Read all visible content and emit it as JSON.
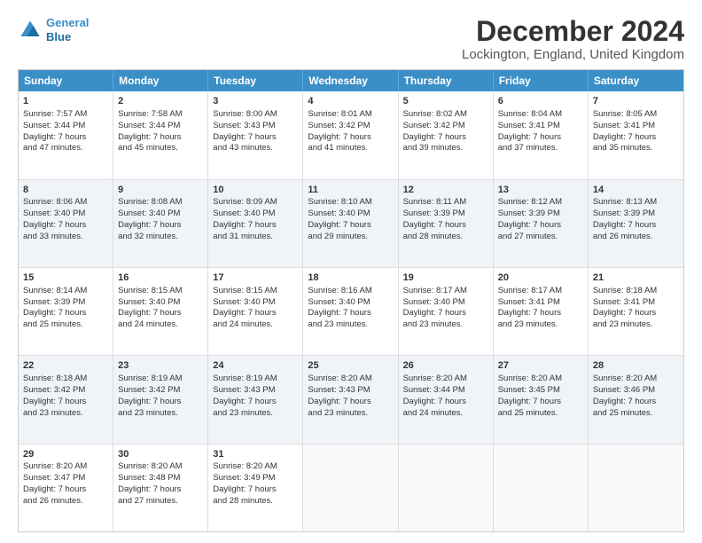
{
  "header": {
    "logo_line1": "General",
    "logo_line2": "Blue",
    "title": "December 2024",
    "subtitle": "Lockington, England, United Kingdom"
  },
  "days": [
    "Sunday",
    "Monday",
    "Tuesday",
    "Wednesday",
    "Thursday",
    "Friday",
    "Saturday"
  ],
  "rows": [
    [
      {
        "day": 1,
        "rise": "7:57 AM",
        "set": "3:44 PM",
        "daylight": "7 hours and 47 minutes."
      },
      {
        "day": 2,
        "rise": "7:58 AM",
        "set": "3:44 PM",
        "daylight": "7 hours and 45 minutes."
      },
      {
        "day": 3,
        "rise": "8:00 AM",
        "set": "3:43 PM",
        "daylight": "7 hours and 43 minutes."
      },
      {
        "day": 4,
        "rise": "8:01 AM",
        "set": "3:42 PM",
        "daylight": "7 hours and 41 minutes."
      },
      {
        "day": 5,
        "rise": "8:02 AM",
        "set": "3:42 PM",
        "daylight": "7 hours and 39 minutes."
      },
      {
        "day": 6,
        "rise": "8:04 AM",
        "set": "3:41 PM",
        "daylight": "7 hours and 37 minutes."
      },
      {
        "day": 7,
        "rise": "8:05 AM",
        "set": "3:41 PM",
        "daylight": "7 hours and 35 minutes."
      }
    ],
    [
      {
        "day": 8,
        "rise": "8:06 AM",
        "set": "3:40 PM",
        "daylight": "7 hours and 33 minutes."
      },
      {
        "day": 9,
        "rise": "8:08 AM",
        "set": "3:40 PM",
        "daylight": "7 hours and 32 minutes."
      },
      {
        "day": 10,
        "rise": "8:09 AM",
        "set": "3:40 PM",
        "daylight": "7 hours and 31 minutes."
      },
      {
        "day": 11,
        "rise": "8:10 AM",
        "set": "3:40 PM",
        "daylight": "7 hours and 29 minutes."
      },
      {
        "day": 12,
        "rise": "8:11 AM",
        "set": "3:39 PM",
        "daylight": "7 hours and 28 minutes."
      },
      {
        "day": 13,
        "rise": "8:12 AM",
        "set": "3:39 PM",
        "daylight": "7 hours and 27 minutes."
      },
      {
        "day": 14,
        "rise": "8:13 AM",
        "set": "3:39 PM",
        "daylight": "7 hours and 26 minutes."
      }
    ],
    [
      {
        "day": 15,
        "rise": "8:14 AM",
        "set": "3:39 PM",
        "daylight": "7 hours and 25 minutes."
      },
      {
        "day": 16,
        "rise": "8:15 AM",
        "set": "3:40 PM",
        "daylight": "7 hours and 24 minutes."
      },
      {
        "day": 17,
        "rise": "8:15 AM",
        "set": "3:40 PM",
        "daylight": "7 hours and 24 minutes."
      },
      {
        "day": 18,
        "rise": "8:16 AM",
        "set": "3:40 PM",
        "daylight": "7 hours and 23 minutes."
      },
      {
        "day": 19,
        "rise": "8:17 AM",
        "set": "3:40 PM",
        "daylight": "7 hours and 23 minutes."
      },
      {
        "day": 20,
        "rise": "8:17 AM",
        "set": "3:41 PM",
        "daylight": "7 hours and 23 minutes."
      },
      {
        "day": 21,
        "rise": "8:18 AM",
        "set": "3:41 PM",
        "daylight": "7 hours and 23 minutes."
      }
    ],
    [
      {
        "day": 22,
        "rise": "8:18 AM",
        "set": "3:42 PM",
        "daylight": "7 hours and 23 minutes."
      },
      {
        "day": 23,
        "rise": "8:19 AM",
        "set": "3:42 PM",
        "daylight": "7 hours and 23 minutes."
      },
      {
        "day": 24,
        "rise": "8:19 AM",
        "set": "3:43 PM",
        "daylight": "7 hours and 23 minutes."
      },
      {
        "day": 25,
        "rise": "8:20 AM",
        "set": "3:43 PM",
        "daylight": "7 hours and 23 minutes."
      },
      {
        "day": 26,
        "rise": "8:20 AM",
        "set": "3:44 PM",
        "daylight": "7 hours and 24 minutes."
      },
      {
        "day": 27,
        "rise": "8:20 AM",
        "set": "3:45 PM",
        "daylight": "7 hours and 25 minutes."
      },
      {
        "day": 28,
        "rise": "8:20 AM",
        "set": "3:46 PM",
        "daylight": "7 hours and 25 minutes."
      }
    ],
    [
      {
        "day": 29,
        "rise": "8:20 AM",
        "set": "3:47 PM",
        "daylight": "7 hours and 26 minutes."
      },
      {
        "day": 30,
        "rise": "8:20 AM",
        "set": "3:48 PM",
        "daylight": "7 hours and 27 minutes."
      },
      {
        "day": 31,
        "rise": "8:20 AM",
        "set": "3:49 PM",
        "daylight": "7 hours and 28 minutes."
      },
      null,
      null,
      null,
      null
    ]
  ],
  "alt_rows": [
    1,
    3
  ],
  "labels": {
    "sunrise": "Sunrise:",
    "sunset": "Sunset:",
    "daylight": "Daylight:"
  }
}
